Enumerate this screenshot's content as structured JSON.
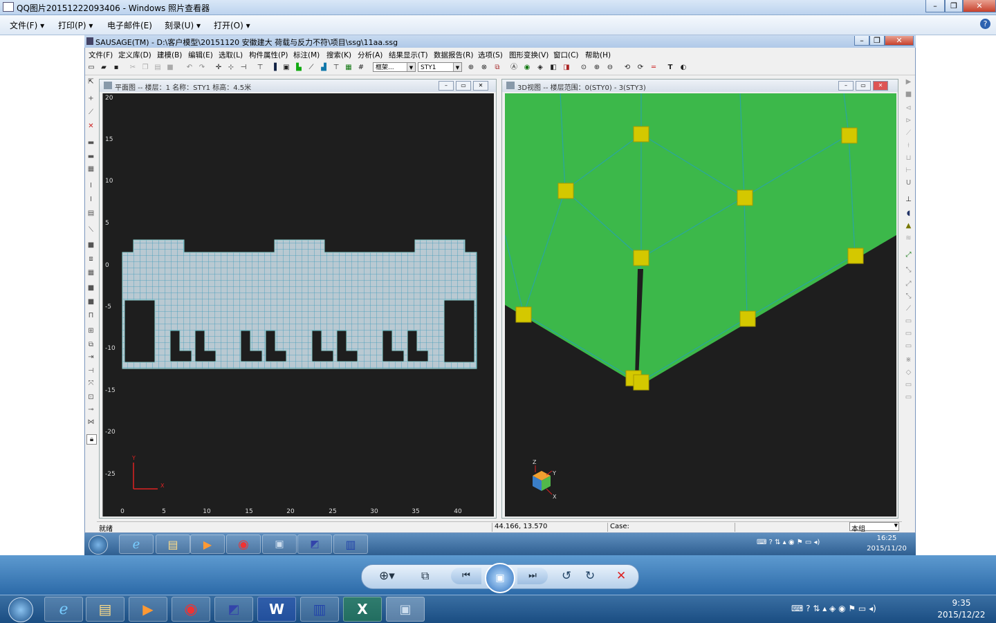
{
  "photo_viewer": {
    "title": "QQ图片20151222093406 - Windows 照片查看器",
    "menu": [
      "文件(F)",
      "打印(P)",
      "电子邮件(E)",
      "刻录(U)",
      "打开(O)"
    ],
    "help_symbol": "?"
  },
  "app": {
    "title": "SAUSAGE(TM) - D:\\客户模型\\20151120 安徽建大 荷载与反力不符\\项目\\ssg\\11aa.ssg",
    "menu": [
      "文件(F)",
      "定义库(D)",
      "建模(B)",
      "编辑(E)",
      "选取(L)",
      "构件属性(P)",
      "标注(M)",
      "搜索(K)",
      "分析(A)",
      "结果显示(T)",
      "数据报告(R)",
      "选项(S)",
      "图形变换(V)",
      "窗口(C)",
      "帮助(H)"
    ],
    "toolbar_combo1": "框架...",
    "toolbar_combo2": "STY1",
    "toolbar_text_btn": "T"
  },
  "plan_view": {
    "title": "平面图 -- 楼层：1  名称：STY1  标高：4.5米",
    "y_ticks": [
      "20",
      "15",
      "10",
      "5",
      "0",
      "-5",
      "-10",
      "-15",
      "-20",
      "-25"
    ],
    "x_ticks": [
      "0",
      "5",
      "10",
      "15",
      "20",
      "25",
      "30",
      "35",
      "40"
    ],
    "axis_x": "X",
    "axis_y": "Y"
  },
  "view3d": {
    "title": "3D视图 -- 楼层范围：0(STY0) - 3(STY3)",
    "axis_x": "X",
    "axis_y": "Y",
    "axis_z": "Z"
  },
  "status": {
    "ready": "就绪",
    "coords": "44.166, 13.570",
    "case": "Case:",
    "group": "本组"
  },
  "inner_tray": {
    "time": "16:25",
    "date": "2015/11/20"
  },
  "outer_tray": {
    "time": "9:35",
    "date": "2015/12/22"
  },
  "colors": {
    "canvas_bg": "#1e1e1e",
    "mesh": "#9bc8d8",
    "green": "#3cb84a",
    "node": "#d4c800"
  }
}
